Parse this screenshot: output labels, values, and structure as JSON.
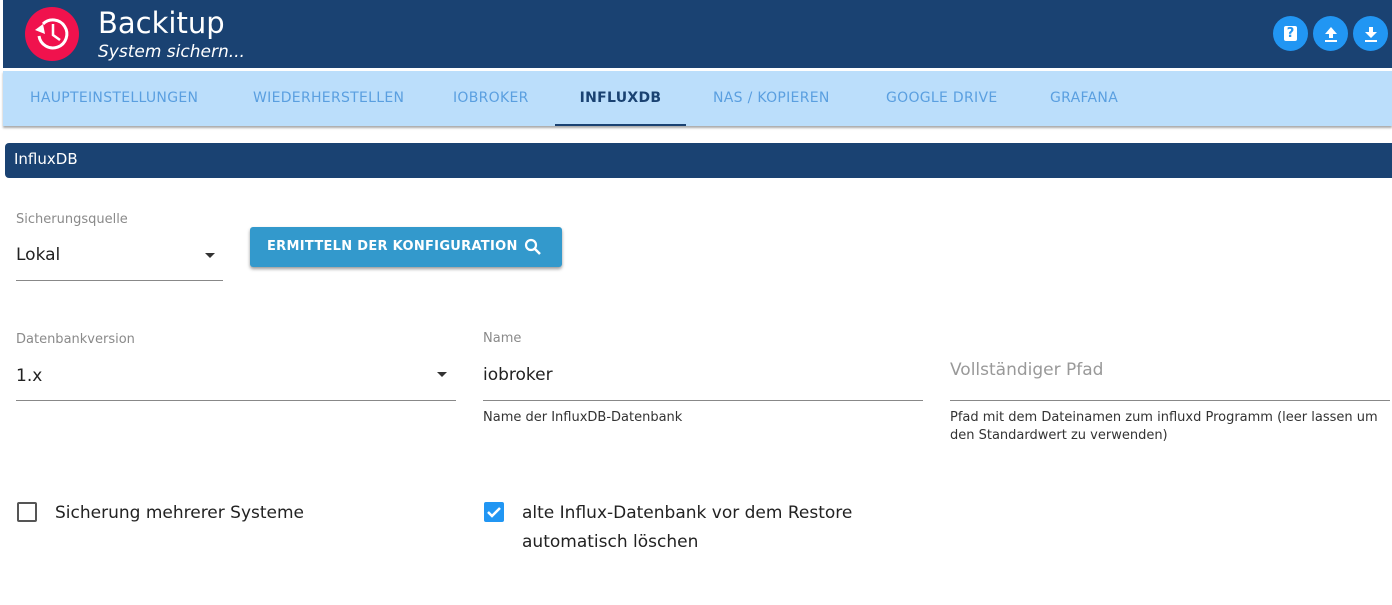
{
  "header": {
    "title": "Backitup",
    "subtitle": "System sichern..."
  },
  "tabs": [
    {
      "label": "HAUPTEINSTELLUNGEN"
    },
    {
      "label": "WIEDERHERSTELLEN"
    },
    {
      "label": "IOBROKER"
    },
    {
      "label": "INFLUXDB"
    },
    {
      "label": "NAS / KOPIEREN"
    },
    {
      "label": "GOOGLE DRIVE"
    },
    {
      "label": "GRAFANA"
    }
  ],
  "section": {
    "title": "InfluxDB"
  },
  "source": {
    "label": "Sicherungsquelle",
    "value": "Lokal"
  },
  "detect_button": "ERMITTELN DER KONFIGURATION",
  "db_version": {
    "label": "Datenbankversion",
    "value": "1.x"
  },
  "name": {
    "label": "Name",
    "value": "iobroker",
    "help": "Name der InfluxDB-Datenbank"
  },
  "path": {
    "placeholder": "Vollständiger Pfad",
    "help": "Pfad mit dem Dateinamen zum influxd Programm (leer lassen um den Standardwert zu verwenden)"
  },
  "multi_system": {
    "label": "Sicherung mehrerer Systeme",
    "checked": false
  },
  "delete_old": {
    "label": "alte Influx-Datenbank vor dem Restore automatisch löschen",
    "checked": true
  }
}
